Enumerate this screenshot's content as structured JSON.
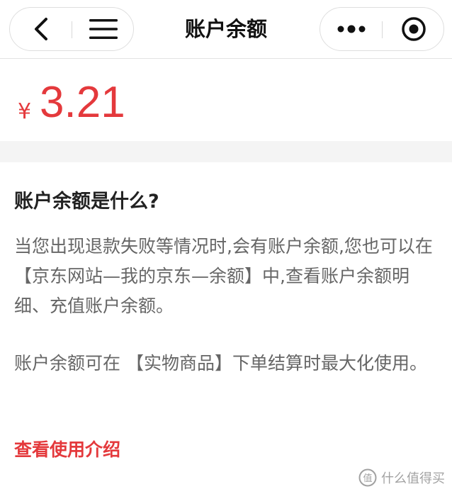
{
  "nav": {
    "title": "账户余额",
    "back_icon": "chevron-left-icon",
    "menu_icon": "hamburger-menu-icon",
    "more_icon": "more-dots-icon",
    "close_icon": "target-circle-icon"
  },
  "balance": {
    "currency": "¥",
    "amount": "3.21"
  },
  "info": {
    "title": "账户余额是什么?",
    "paragraph1": "当您出现退款失败等情况时,会有账户余额,您也可以在 【京东网站—我的京东—余额】中,查看账户余额明细、充值账户余额。",
    "paragraph2": "账户余额可在 【实物商品】下单结算时最大化使用。",
    "link": "查看使用介绍"
  },
  "watermark": {
    "text": "什么值得买"
  },
  "colors": {
    "accent": "#e4393c",
    "text_primary": "#222222",
    "text_secondary": "#666666",
    "gap_background": "#f4f4f4"
  }
}
